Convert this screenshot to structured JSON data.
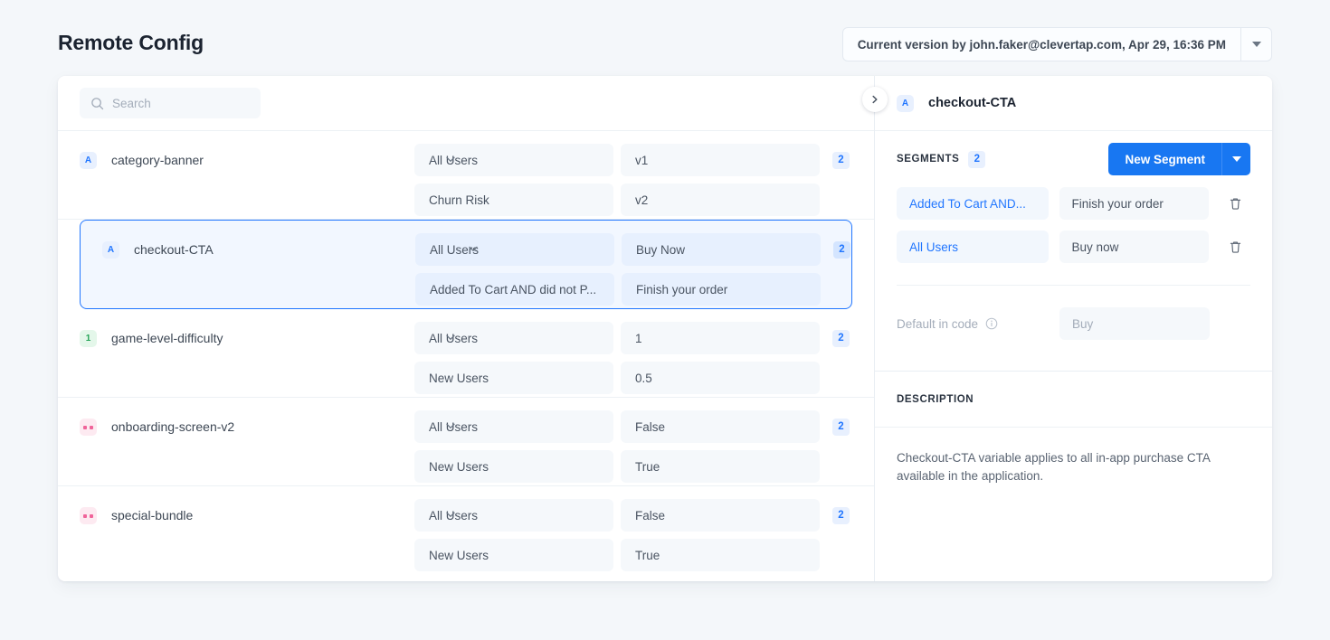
{
  "header": {
    "title": "Remote Config",
    "version_selector": {
      "label": "Current version by john.faker@clevertap.com, Apr 29, 16:36 PM",
      "caret_icon": "chevron-down-icon"
    }
  },
  "search": {
    "placeholder": "Search",
    "value": "",
    "icon": "search-icon"
  },
  "variables": [
    {
      "name": "category-banner",
      "type": "string",
      "type_badge": "A",
      "count": "2",
      "selected": false,
      "rules": [
        {
          "segment": "All Users",
          "value": "v1"
        },
        {
          "segment": "Churn Risk",
          "value": "v2"
        }
      ]
    },
    {
      "name": "checkout-CTA",
      "type": "string",
      "type_badge": "A",
      "count": "2",
      "selected": true,
      "rules": [
        {
          "segment": "All Users",
          "value": "Buy Now"
        },
        {
          "segment": "Added To Cart AND did not P...",
          "value": "Finish your order"
        }
      ]
    },
    {
      "name": "game-level-difficulty",
      "type": "number",
      "type_badge": "1",
      "count": "2",
      "selected": false,
      "rules": [
        {
          "segment": "All Users",
          "value": "1"
        },
        {
          "segment": "New Users",
          "value": "0.5"
        }
      ]
    },
    {
      "name": "onboarding-screen-v2",
      "type": "boolean",
      "type_badge": "",
      "count": "2",
      "selected": false,
      "rules": [
        {
          "segment": "All Users",
          "value": "False"
        },
        {
          "segment": "New Users",
          "value": "True"
        }
      ]
    },
    {
      "name": "special-bundle",
      "type": "boolean",
      "type_badge": "",
      "count": "2",
      "selected": false,
      "rules": [
        {
          "segment": "All Users",
          "value": "False"
        },
        {
          "segment": "New Users",
          "value": "True"
        }
      ]
    }
  ],
  "detail": {
    "collapse_icon": "chevron-right-icon",
    "title": "checkout-CTA",
    "type_badge": "A",
    "segments_label": "SEGMENTS",
    "segments_count": "2",
    "new_segment_button": "New Segment",
    "new_segment_caret_icon": "chevron-down-icon",
    "segments": [
      {
        "name": "Added To Cart AND...",
        "value": "Finish your order",
        "delete_icon": "trash-icon"
      },
      {
        "name": "All Users",
        "value": "Buy now",
        "delete_icon": "trash-icon"
      }
    ],
    "default": {
      "label": "Default in code",
      "info_icon": "info-icon",
      "value": "Buy"
    },
    "description_label": "DESCRIPTION",
    "description_text": "Checkout-CTA variable applies to all in-app purchase CTA available in the application."
  },
  "colors": {
    "accent": "#1877f2",
    "link": "#2176ff",
    "page_bg": "#f4f7fa",
    "badge_string": "#2176ff",
    "badge_number": "#23a355",
    "badge_boolean": "#f0649a"
  }
}
